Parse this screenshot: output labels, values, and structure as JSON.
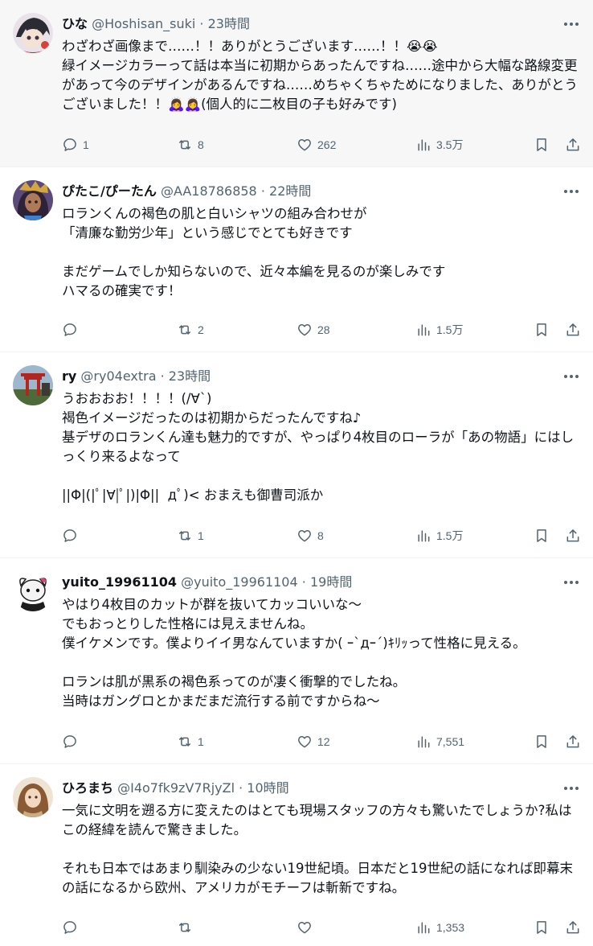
{
  "posts": [
    {
      "name": "ひな",
      "handle": "@Hoshisan_suki",
      "sep": "·",
      "time": "23時間",
      "text": "わざわざ画像まで……！！ありがとうございます……！！😭😭\n緑イメージカラーって話は本当に初期からあったんですね……途中から大幅な路線変更があって今のデザインがあるんですね……めちゃくちゃためになりました、ありがとうございました！！🙇‍♀️🙇‍♀️(個人的に二枚目の子も好みです)",
      "replies": "1",
      "reposts": "8",
      "likes": "262",
      "views": "3.5万"
    },
    {
      "name": "ぴたこ/ぴーたん",
      "handle": "@AA18786858",
      "sep": "·",
      "time": "22時間",
      "text": "ロランくんの褐色の肌と白いシャツの組み合わせが\n「清廉な勤労少年」という感じでとても好きです\n\nまだゲームでしか知らないので、近々本編を見るのが楽しみです\nハマるの確実です！",
      "replies": "",
      "reposts": "2",
      "likes": "28",
      "views": "1.5万"
    },
    {
      "name": "ry",
      "handle": "@ry04extra",
      "sep": "·",
      "time": "23時間",
      "text": "うおおおお！！！！(/∀`)\n褐色イメージだったのは初期からだったんですね♪\n基デザのロランくん達も魅力的ですが、やっぱり4枚目のローラが「あの物語」にはしっくり来るよなって\n\n||Φ|(|ﾟ|∀|ﾟ|)|Φ||  дﾟ)< おまえも御曹司派か",
      "replies": "",
      "reposts": "1",
      "likes": "8",
      "views": "1.5万"
    },
    {
      "name": "yuito_19961104",
      "handle": "@yuito_19961104",
      "sep": "·",
      "time": "19時間",
      "text": "やはり4枚目のカットが群を抜いてカッコいいな～\nでもおっとりした性格には見えませんね。\n僕イケメンです。僕よりイイ男なんていますか( ｰ`дｰ´)ｷﾘｯって性格に見える。\n\nロランは肌が黒系の褐色系ってのが凄く衝撃的でしたね。\n当時はガングロとかまだまだ流行する前ですからね～",
      "replies": "",
      "reposts": "1",
      "likes": "12",
      "views": "7,551"
    },
    {
      "name": "ひろまち",
      "handle": "@I4o7fk9zV7RjyZl",
      "sep": "·",
      "time": "10時間",
      "text": "一気に文明を遡る方に変えたのはとても現場スタッフの方々も驚いたでしょうか?私はこの経緯を読んで驚きました。\n\nそれも日本ではあまり馴染みの少ない19世紀頃。日本だと19世紀の話になれば即幕末の話になるから欧州、アメリカがモチーフは斬新ですね。",
      "replies": "",
      "reposts": "",
      "likes": "",
      "views": "1,353"
    }
  ],
  "icons": {
    "more": "more-dots-icon",
    "reply": "reply-icon",
    "repost": "repost-icon",
    "like": "heart-icon",
    "views": "views-icon",
    "bookmark": "bookmark-icon",
    "share": "share-icon"
  },
  "colors": {
    "text": "#0f1419",
    "secondary": "#536471",
    "highlight_bg": "#f7f7f7",
    "divider": "#eff3f4"
  }
}
